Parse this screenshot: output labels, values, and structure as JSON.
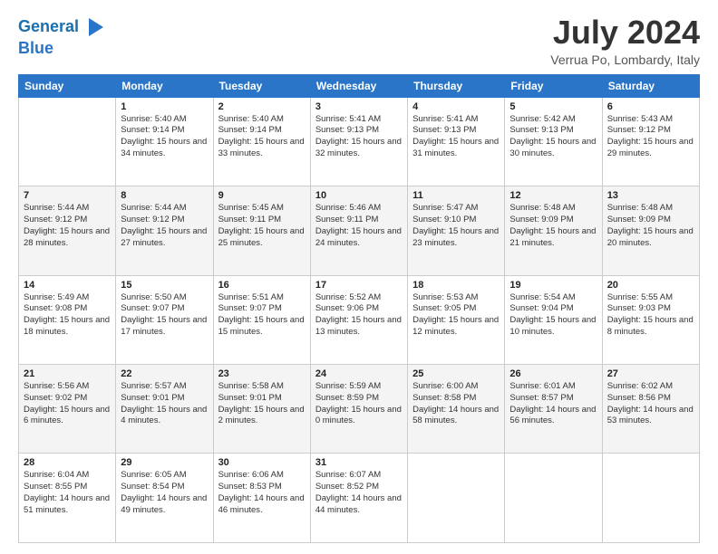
{
  "header": {
    "logo_line1": "General",
    "logo_line2": "Blue",
    "month_title": "July 2024",
    "location": "Verrua Po, Lombardy, Italy"
  },
  "weekdays": [
    "Sunday",
    "Monday",
    "Tuesday",
    "Wednesday",
    "Thursday",
    "Friday",
    "Saturday"
  ],
  "weeks": [
    [
      {
        "date": "",
        "sunrise": "",
        "sunset": "",
        "daylight": ""
      },
      {
        "date": "1",
        "sunrise": "Sunrise: 5:40 AM",
        "sunset": "Sunset: 9:14 PM",
        "daylight": "Daylight: 15 hours and 34 minutes."
      },
      {
        "date": "2",
        "sunrise": "Sunrise: 5:40 AM",
        "sunset": "Sunset: 9:14 PM",
        "daylight": "Daylight: 15 hours and 33 minutes."
      },
      {
        "date": "3",
        "sunrise": "Sunrise: 5:41 AM",
        "sunset": "Sunset: 9:13 PM",
        "daylight": "Daylight: 15 hours and 32 minutes."
      },
      {
        "date": "4",
        "sunrise": "Sunrise: 5:41 AM",
        "sunset": "Sunset: 9:13 PM",
        "daylight": "Daylight: 15 hours and 31 minutes."
      },
      {
        "date": "5",
        "sunrise": "Sunrise: 5:42 AM",
        "sunset": "Sunset: 9:13 PM",
        "daylight": "Daylight: 15 hours and 30 minutes."
      },
      {
        "date": "6",
        "sunrise": "Sunrise: 5:43 AM",
        "sunset": "Sunset: 9:12 PM",
        "daylight": "Daylight: 15 hours and 29 minutes."
      }
    ],
    [
      {
        "date": "7",
        "sunrise": "Sunrise: 5:44 AM",
        "sunset": "Sunset: 9:12 PM",
        "daylight": "Daylight: 15 hours and 28 minutes."
      },
      {
        "date": "8",
        "sunrise": "Sunrise: 5:44 AM",
        "sunset": "Sunset: 9:12 PM",
        "daylight": "Daylight: 15 hours and 27 minutes."
      },
      {
        "date": "9",
        "sunrise": "Sunrise: 5:45 AM",
        "sunset": "Sunset: 9:11 PM",
        "daylight": "Daylight: 15 hours and 25 minutes."
      },
      {
        "date": "10",
        "sunrise": "Sunrise: 5:46 AM",
        "sunset": "Sunset: 9:11 PM",
        "daylight": "Daylight: 15 hours and 24 minutes."
      },
      {
        "date": "11",
        "sunrise": "Sunrise: 5:47 AM",
        "sunset": "Sunset: 9:10 PM",
        "daylight": "Daylight: 15 hours and 23 minutes."
      },
      {
        "date": "12",
        "sunrise": "Sunrise: 5:48 AM",
        "sunset": "Sunset: 9:09 PM",
        "daylight": "Daylight: 15 hours and 21 minutes."
      },
      {
        "date": "13",
        "sunrise": "Sunrise: 5:48 AM",
        "sunset": "Sunset: 9:09 PM",
        "daylight": "Daylight: 15 hours and 20 minutes."
      }
    ],
    [
      {
        "date": "14",
        "sunrise": "Sunrise: 5:49 AM",
        "sunset": "Sunset: 9:08 PM",
        "daylight": "Daylight: 15 hours and 18 minutes."
      },
      {
        "date": "15",
        "sunrise": "Sunrise: 5:50 AM",
        "sunset": "Sunset: 9:07 PM",
        "daylight": "Daylight: 15 hours and 17 minutes."
      },
      {
        "date": "16",
        "sunrise": "Sunrise: 5:51 AM",
        "sunset": "Sunset: 9:07 PM",
        "daylight": "Daylight: 15 hours and 15 minutes."
      },
      {
        "date": "17",
        "sunrise": "Sunrise: 5:52 AM",
        "sunset": "Sunset: 9:06 PM",
        "daylight": "Daylight: 15 hours and 13 minutes."
      },
      {
        "date": "18",
        "sunrise": "Sunrise: 5:53 AM",
        "sunset": "Sunset: 9:05 PM",
        "daylight": "Daylight: 15 hours and 12 minutes."
      },
      {
        "date": "19",
        "sunrise": "Sunrise: 5:54 AM",
        "sunset": "Sunset: 9:04 PM",
        "daylight": "Daylight: 15 hours and 10 minutes."
      },
      {
        "date": "20",
        "sunrise": "Sunrise: 5:55 AM",
        "sunset": "Sunset: 9:03 PM",
        "daylight": "Daylight: 15 hours and 8 minutes."
      }
    ],
    [
      {
        "date": "21",
        "sunrise": "Sunrise: 5:56 AM",
        "sunset": "Sunset: 9:02 PM",
        "daylight": "Daylight: 15 hours and 6 minutes."
      },
      {
        "date": "22",
        "sunrise": "Sunrise: 5:57 AM",
        "sunset": "Sunset: 9:01 PM",
        "daylight": "Daylight: 15 hours and 4 minutes."
      },
      {
        "date": "23",
        "sunrise": "Sunrise: 5:58 AM",
        "sunset": "Sunset: 9:01 PM",
        "daylight": "Daylight: 15 hours and 2 minutes."
      },
      {
        "date": "24",
        "sunrise": "Sunrise: 5:59 AM",
        "sunset": "Sunset: 8:59 PM",
        "daylight": "Daylight: 15 hours and 0 minutes."
      },
      {
        "date": "25",
        "sunrise": "Sunrise: 6:00 AM",
        "sunset": "Sunset: 8:58 PM",
        "daylight": "Daylight: 14 hours and 58 minutes."
      },
      {
        "date": "26",
        "sunrise": "Sunrise: 6:01 AM",
        "sunset": "Sunset: 8:57 PM",
        "daylight": "Daylight: 14 hours and 56 minutes."
      },
      {
        "date": "27",
        "sunrise": "Sunrise: 6:02 AM",
        "sunset": "Sunset: 8:56 PM",
        "daylight": "Daylight: 14 hours and 53 minutes."
      }
    ],
    [
      {
        "date": "28",
        "sunrise": "Sunrise: 6:04 AM",
        "sunset": "Sunset: 8:55 PM",
        "daylight": "Daylight: 14 hours and 51 minutes."
      },
      {
        "date": "29",
        "sunrise": "Sunrise: 6:05 AM",
        "sunset": "Sunset: 8:54 PM",
        "daylight": "Daylight: 14 hours and 49 minutes."
      },
      {
        "date": "30",
        "sunrise": "Sunrise: 6:06 AM",
        "sunset": "Sunset: 8:53 PM",
        "daylight": "Daylight: 14 hours and 46 minutes."
      },
      {
        "date": "31",
        "sunrise": "Sunrise: 6:07 AM",
        "sunset": "Sunset: 8:52 PM",
        "daylight": "Daylight: 14 hours and 44 minutes."
      },
      {
        "date": "",
        "sunrise": "",
        "sunset": "",
        "daylight": ""
      },
      {
        "date": "",
        "sunrise": "",
        "sunset": "",
        "daylight": ""
      },
      {
        "date": "",
        "sunrise": "",
        "sunset": "",
        "daylight": ""
      }
    ]
  ]
}
